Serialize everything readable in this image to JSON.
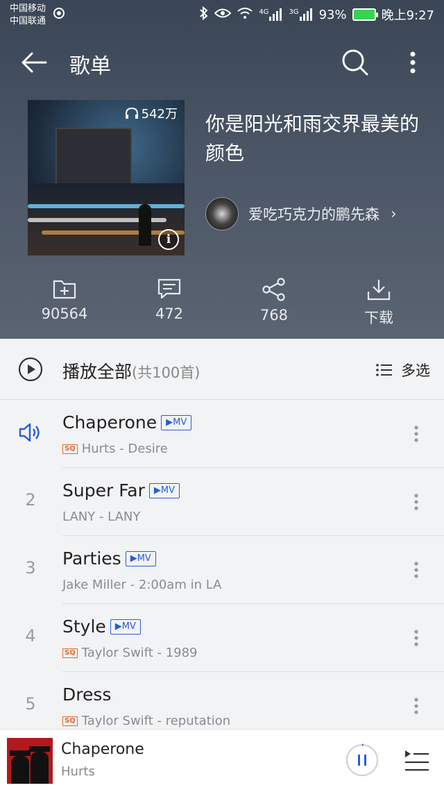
{
  "status_bar": {
    "carrier1": "中国移动",
    "carrier2": "中国联通",
    "net1": "4G",
    "net2": "3G",
    "battery": "93%",
    "time": "晚上9:27"
  },
  "header": {
    "title": "歌单"
  },
  "playlist": {
    "plays": "542万",
    "title": "你是阳光和雨交界最美的颜色",
    "creator": "爱吃巧克力的鹏先森"
  },
  "actions": [
    {
      "label": "90564",
      "icon": "add-folder-icon"
    },
    {
      "label": "472",
      "icon": "comment-icon"
    },
    {
      "label": "768",
      "icon": "share-icon"
    },
    {
      "label": "下载",
      "icon": "download-icon"
    }
  ],
  "play_all": {
    "label": "播放全部",
    "count": "(共100首)",
    "multi_select": "多选"
  },
  "songs": [
    {
      "index": "",
      "playing": true,
      "title": "Chaperone",
      "mv": "MV",
      "sq": true,
      "meta": "Hurts - Desire"
    },
    {
      "index": "2",
      "playing": false,
      "title": "Super Far",
      "mv": "MV",
      "sq": false,
      "meta": "LANY - LANY"
    },
    {
      "index": "3",
      "playing": false,
      "title": "Parties",
      "mv": "MV",
      "sq": false,
      "meta": "Jake Miller - 2:00am in LA"
    },
    {
      "index": "4",
      "playing": false,
      "title": "Style",
      "mv": "MV",
      "sq": true,
      "meta": "Taylor Swift - 1989"
    },
    {
      "index": "5",
      "playing": false,
      "title": "Dress",
      "mv": "",
      "sq": true,
      "meta": "Taylor Swift - reputation"
    }
  ],
  "badges": {
    "sq": "SQ"
  },
  "mini_player": {
    "title": "Chaperone",
    "artist": "Hurts"
  },
  "colors": {
    "accent": "#2a5bd7",
    "sq": "#e06a2c"
  }
}
